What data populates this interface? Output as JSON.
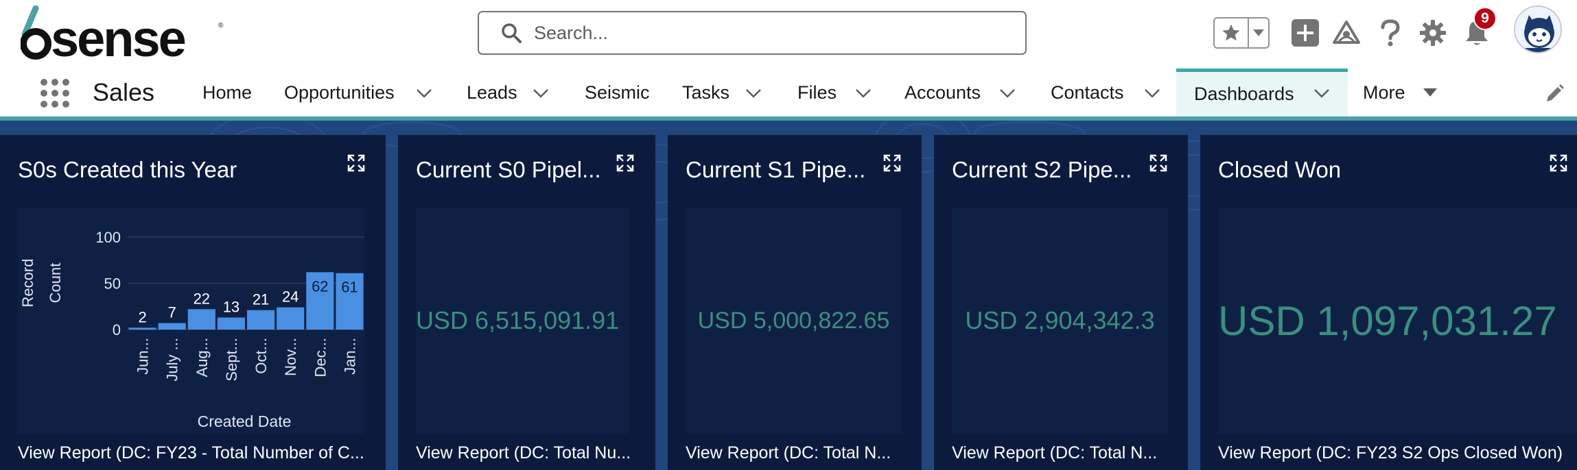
{
  "header": {
    "search": {
      "placeholder": "Search..."
    },
    "notifications": {
      "count": "9"
    }
  },
  "nav": {
    "app_name": "Sales",
    "items": [
      {
        "label": "Home",
        "has_menu": false
      },
      {
        "label": "Opportunities",
        "has_menu": true
      },
      {
        "label": "Leads",
        "has_menu": true
      },
      {
        "label": "Seismic",
        "has_menu": false
      },
      {
        "label": "Tasks",
        "has_menu": true
      },
      {
        "label": "Files",
        "has_menu": true
      },
      {
        "label": "Accounts",
        "has_menu": true
      },
      {
        "label": "Contacts",
        "has_menu": true
      },
      {
        "label": "Dashboards",
        "has_menu": true,
        "active": true
      },
      {
        "label": "More",
        "has_menu": true
      }
    ]
  },
  "colors": {
    "accent": "#3ba7a7",
    "dashboard_bg": "#21467d",
    "card_bg": "#0c1b3d",
    "bar": "#4a90e2",
    "metric_text": "#3c8f7f",
    "badge": "#ba0517"
  },
  "cards": [
    {
      "title": "S0s Created this Year",
      "footer": "View Report (DC: FY23 - Total Number of C..."
    },
    {
      "title": "Current S0 Pipel...",
      "metric": "USD 6,515,091.91",
      "footer": "View Report (DC: Total Nu..."
    },
    {
      "title": "Current S1 Pipe...",
      "metric": "USD 5,000,822.65",
      "footer": "View Report (DC: Total N..."
    },
    {
      "title": "Current S2 Pipe...",
      "metric": "USD 2,904,342.3",
      "footer": "View Report (DC: Total N..."
    },
    {
      "title": "Closed Won",
      "metric": "USD 1,097,031.27",
      "footer": "View Report (DC: FY23 S2 Ops Closed Won)"
    }
  ],
  "chart_data": {
    "type": "bar",
    "categories": [
      "Jun...",
      "July ...",
      "Aug...",
      "Sept...",
      "Oct...",
      "Nov...",
      "Dec...",
      "Jan..."
    ],
    "values": [
      2,
      7,
      22,
      13,
      21,
      24,
      62,
      61
    ],
    "xlabel": "Created Date",
    "ylabel_lines": [
      "Record",
      "Count"
    ],
    "yticks": [
      0,
      50,
      100
    ],
    "ylim": [
      0,
      100
    ],
    "grid": true
  }
}
